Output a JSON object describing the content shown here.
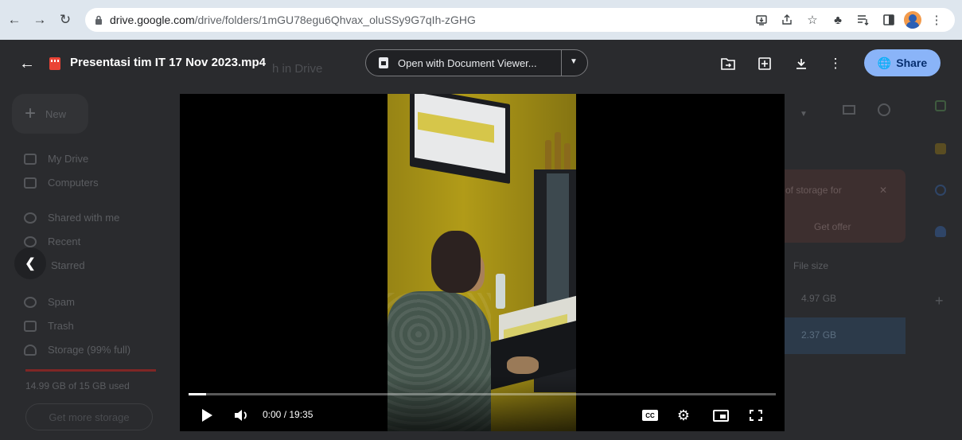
{
  "browser": {
    "url_host": "drive.google.com",
    "url_path": "/drive/folders/1mGU78egu6Qhvax_oluSSy9G7qIh-zGHG"
  },
  "drive_bg": {
    "new_label": "New",
    "nav": [
      "My Drive",
      "Computers",
      "Shared with me",
      "Recent",
      "Starred",
      "Spam",
      "Trash",
      "Storage (99% full)"
    ],
    "storage_used": "14.99 GB of 15 GB used",
    "get_storage": "Get more storage",
    "promo_line": "of storage for",
    "promo_action": "Get offer",
    "file_size_header": "File size",
    "sizes": [
      "4.97 GB",
      "2.37 GB"
    ],
    "behind_text": "h in Drive"
  },
  "viewer": {
    "file_title": "Presentasi tim IT 17 Nov 2023.mp4",
    "open_with_label": "Open with Document Viewer...",
    "share_label": "Share"
  },
  "player": {
    "time": "0:00 / 19:35",
    "progress": 0.03,
    "cc_label": "CC"
  },
  "colors": {
    "accent": "#8ab4f8",
    "chrome": "#dee6ee",
    "video_wall": "#b19b18"
  }
}
